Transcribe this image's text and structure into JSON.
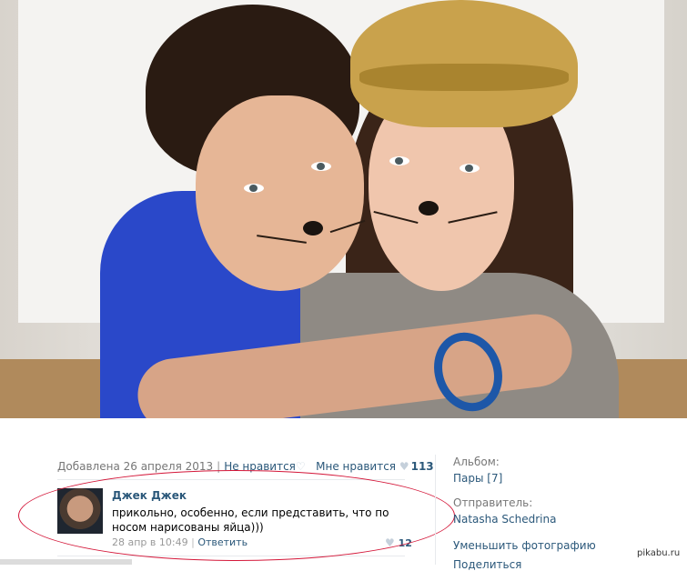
{
  "photo": {
    "alt": ""
  },
  "meta": {
    "added": "Добавлена 26 апреля 2013",
    "dislike": "Не нравится",
    "like": "Мне нравится",
    "likes_count": "113"
  },
  "comment": {
    "author": "Джек Джек",
    "text": "прикольно, особенно, если представить, что по носом нарисованы яйца)))",
    "time": "28 апр в 10:49",
    "reply": "Ответить",
    "likes": "12"
  },
  "sidebar": {
    "album_label": "Альбом:",
    "album_link": "Пары [7]",
    "sender_label": "Отправитель:",
    "sender_link": "Natasha Schedrina",
    "reduce_photo": "Уменьшить фотографию",
    "next_action": "Поделиться"
  },
  "watermark": "pikabu.ru",
  "colors": {
    "link": "#2b587a",
    "muted": "#777777",
    "annotation": "#d4183a"
  }
}
